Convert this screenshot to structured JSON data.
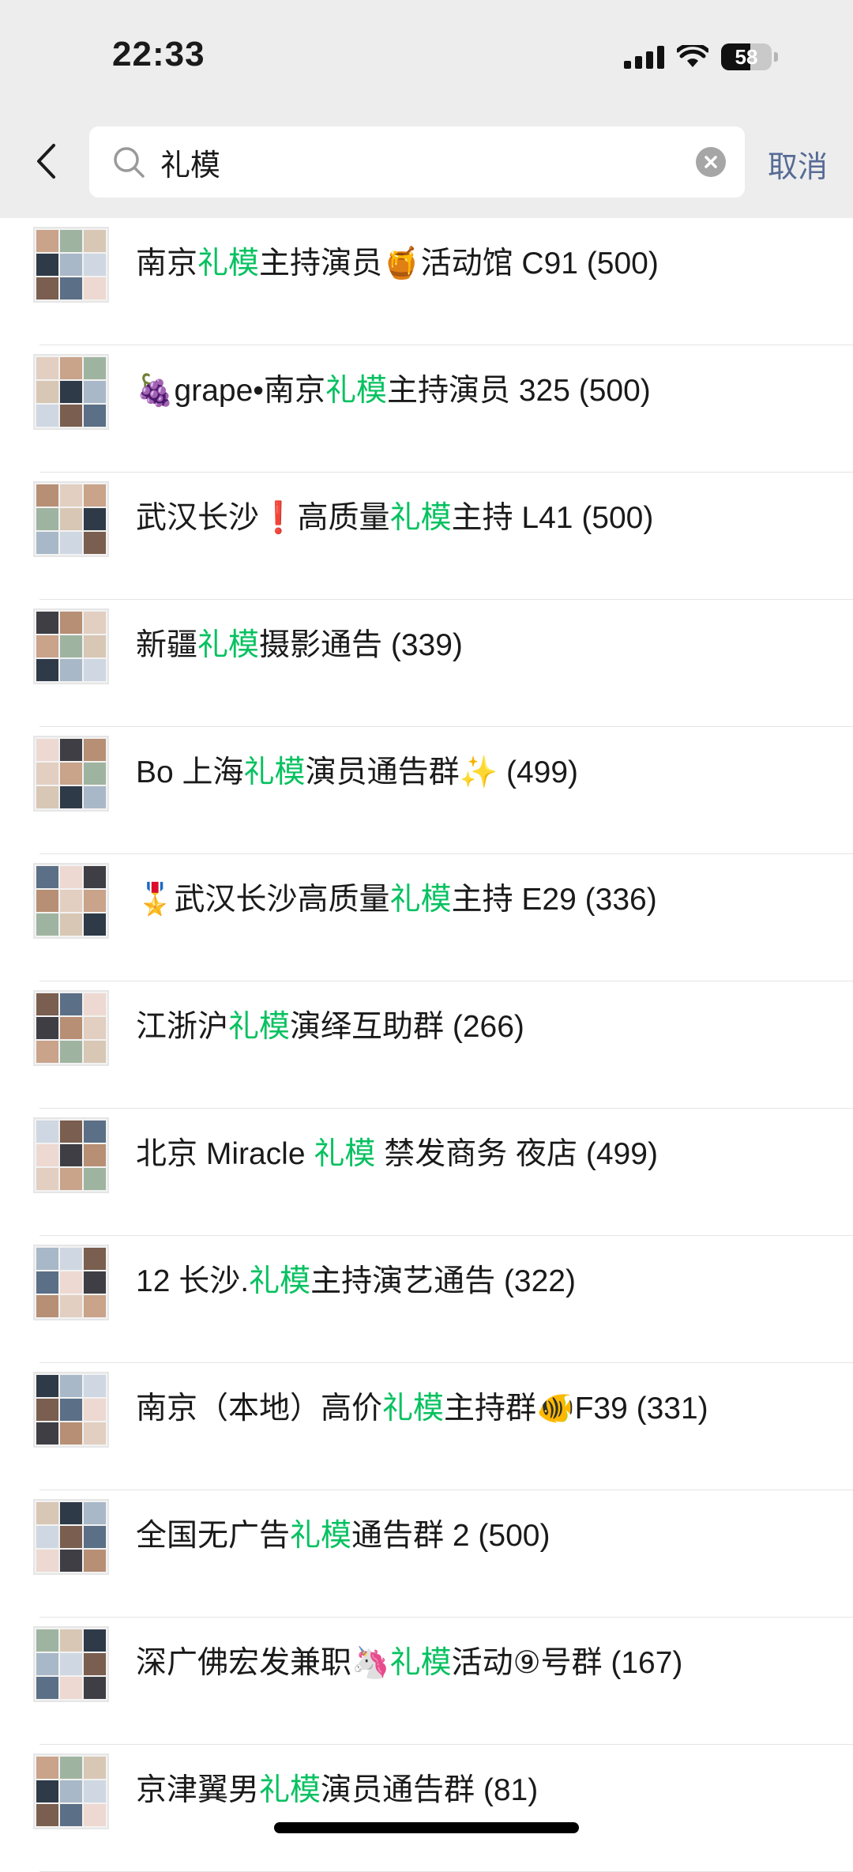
{
  "status_bar": {
    "time": "22:33",
    "battery_level": "58",
    "battery_fraction": 0.58
  },
  "search": {
    "query": "礼模",
    "cancel_label": "取消"
  },
  "highlight_color": "#07c160",
  "results": [
    {
      "before": "南京",
      "match": "礼模",
      "after": "主持演员🍯活动馆 C91 (500)"
    },
    {
      "before": "🍇grape•南京",
      "match": "礼模",
      "after": "主持演员 325 (500)"
    },
    {
      "before": "武汉长沙❗高质量",
      "match": "礼模",
      "after": "主持 L41 (500)"
    },
    {
      "before": "新疆",
      "match": "礼模",
      "after": "摄影通告 (339)"
    },
    {
      "before": "Bo 上海",
      "match": "礼模",
      "after": "演员通告群✨ (499)"
    },
    {
      "before": "🎖️武汉长沙高质量",
      "match": "礼模",
      "after": "主持 E29 (336)"
    },
    {
      "before": "江浙沪",
      "match": "礼模",
      "after": "演绎互助群 (266)"
    },
    {
      "before": "北京 Miracle ",
      "match": "礼模",
      "after": " 禁发商务 夜店 (499)"
    },
    {
      "before": "12 长沙.",
      "match": "礼模",
      "after": "主持演艺通告 (322)"
    },
    {
      "before": "南京（本地）高价",
      "match": "礼模",
      "after": "主持群🐠F39 (331)"
    },
    {
      "before": "全国无广告",
      "match": "礼模",
      "after": "通告群 2 (500)"
    },
    {
      "before": "深广佛宏发兼职🦄",
      "match": "礼模",
      "after": "活动⑨号群 (167)"
    },
    {
      "before": "京津翼男",
      "match": "礼模",
      "after": "演员通告群 (81)"
    }
  ]
}
